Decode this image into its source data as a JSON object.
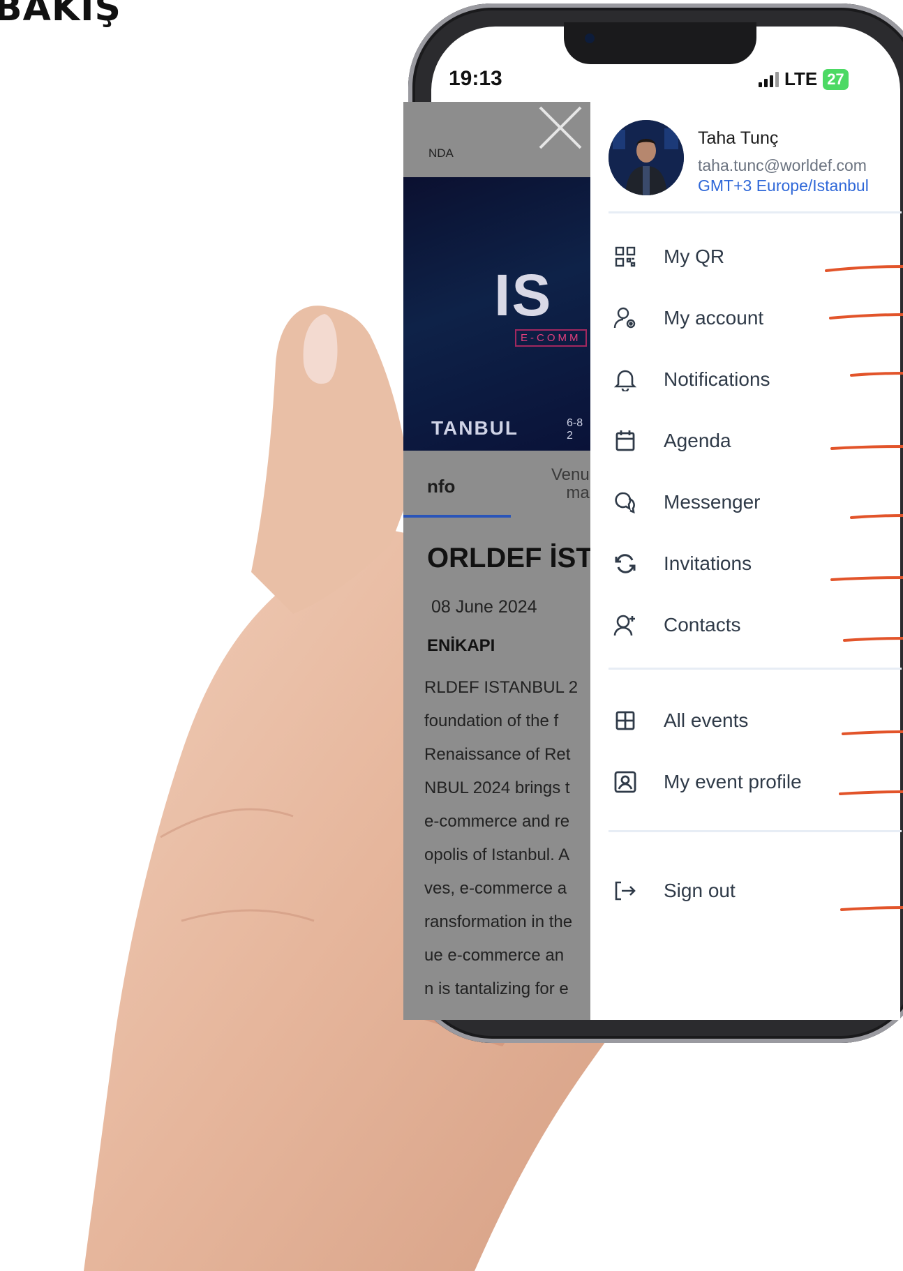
{
  "heading": "BAKIŞ",
  "status_bar": {
    "time": "19:13",
    "network": "LTE",
    "battery": "27"
  },
  "background_app": {
    "section_label": "NDA",
    "banner": {
      "city_top": "IS",
      "subtitle": "E-COMM",
      "city_bottom": "TANBUL",
      "dates": "6-8\n2"
    },
    "tabs": {
      "info": "nfo",
      "venue": "Venu\nma"
    },
    "title": "ORLDEF İST",
    "date": "08 June 2024",
    "venue": "ENİKAPI",
    "description_lines": [
      "RLDEF ISTANBUL 2",
      " foundation of the f",
      " Renaissance of Ret",
      "NBUL 2024 brings t",
      "e-commerce and re",
      "opolis of Istanbul. A",
      "ves, e-commerce a",
      "ransformation in the",
      "ue e-commerce an",
      "n is tantalizing for e"
    ]
  },
  "profile": {
    "name": "Taha Tunç",
    "email": "taha.tunc@worldef.com",
    "timezone": "GMT+3 Europe/Istanbul"
  },
  "menu": [
    {
      "label": "My QR",
      "icon": "qr-code-icon"
    },
    {
      "label": "My account",
      "icon": "account-settings-icon"
    },
    {
      "label": "Notifications",
      "icon": "bell-icon"
    },
    {
      "label": "Agenda",
      "icon": "calendar-icon"
    },
    {
      "label": "Messenger",
      "icon": "chat-icon"
    },
    {
      "label": "Invitations",
      "icon": "refresh-icon"
    },
    {
      "label": "Contacts",
      "icon": "add-contact-icon"
    }
  ],
  "menu_events": [
    {
      "label": "All events",
      "icon": "grid-icon"
    },
    {
      "label": "My event profile",
      "icon": "profile-card-icon"
    }
  ],
  "menu_footer": [
    {
      "label": "Sign out",
      "icon": "sign-out-icon"
    }
  ],
  "colors": {
    "accent": "#2e67d8",
    "annotation": "#e2542a",
    "menu_text": "#2f3a48",
    "battery": "#4cd964"
  }
}
